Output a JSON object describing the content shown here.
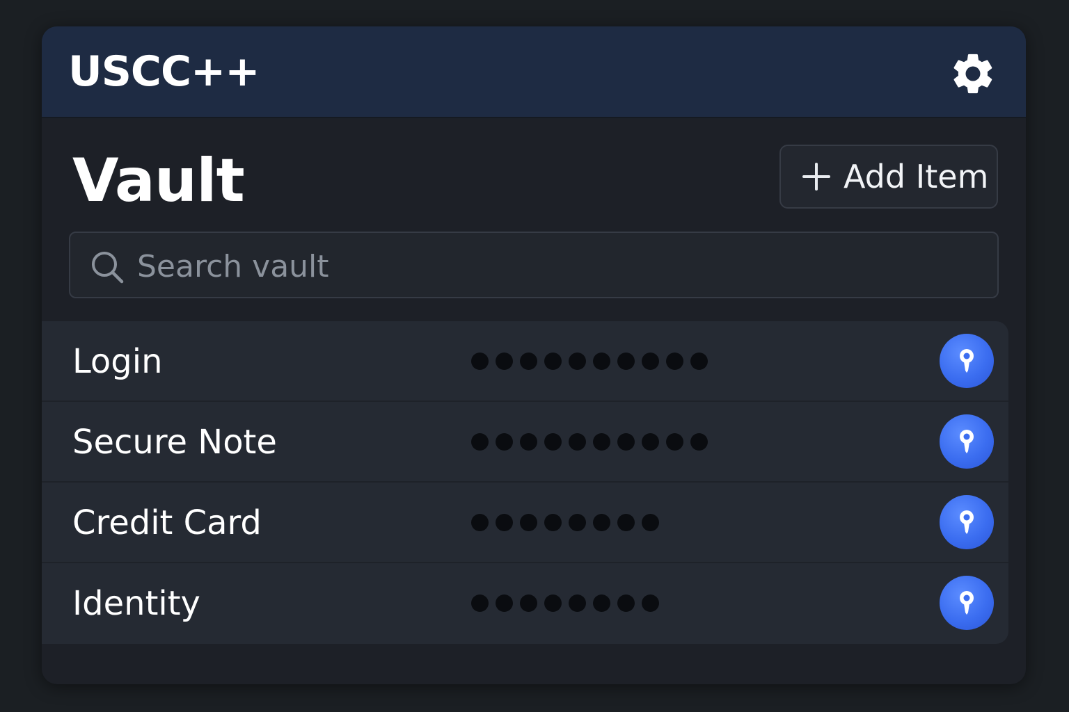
{
  "header": {
    "app_title": "USCC++",
    "settings_icon": "gear-icon"
  },
  "main": {
    "title": "Vault",
    "add_button_label": "Add Item",
    "search_placeholder": "Search vault"
  },
  "items": [
    {
      "name": "Login",
      "masked_length": 10
    },
    {
      "name": "Secure Note",
      "masked_length": 10
    },
    {
      "name": "Credit Card",
      "masked_length": 8
    },
    {
      "name": "Identity",
      "masked_length": 8
    }
  ],
  "colors": {
    "accent": "#3b6df0",
    "header_bg": "#1e2b43",
    "window_bg": "#1d2027",
    "list_bg": "#252a33"
  }
}
